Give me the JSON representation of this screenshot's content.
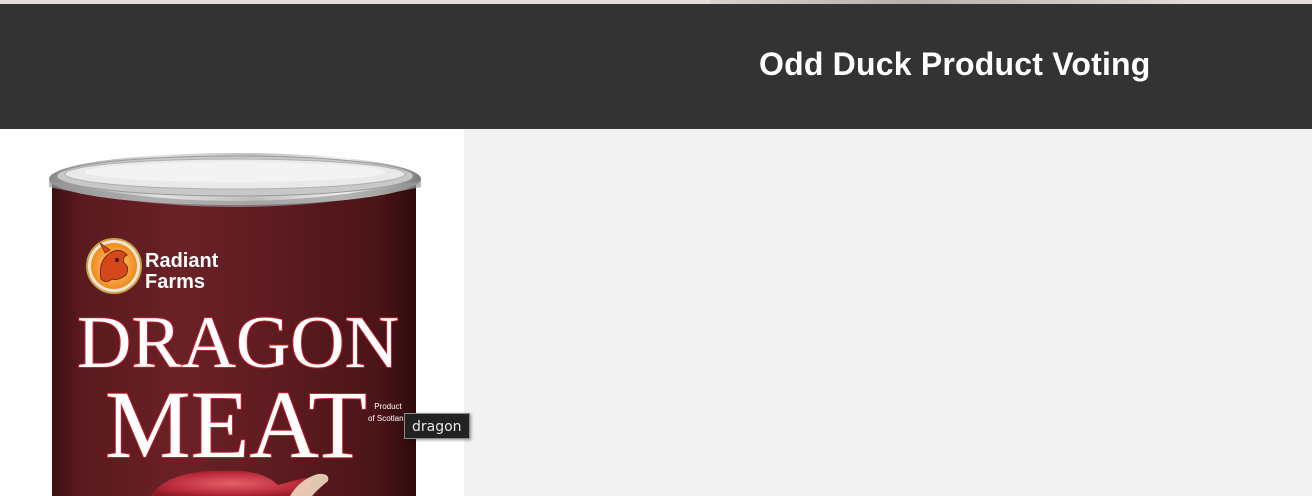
{
  "page": {
    "title": "Odd Duck Product Voting"
  },
  "product_image": {
    "alt": "dragon",
    "tooltip": "dragon",
    "brand_line1": "Radiant",
    "brand_line2": "Farms",
    "name_line1": "DRAGON",
    "name_line2": "MEAT",
    "origin_line1": "Product",
    "origin_line2": "of Scotland"
  },
  "colors": {
    "header_bg": "#333333",
    "page_bg": "#f2f2f2",
    "can_maroon": "#5e1a1f"
  }
}
